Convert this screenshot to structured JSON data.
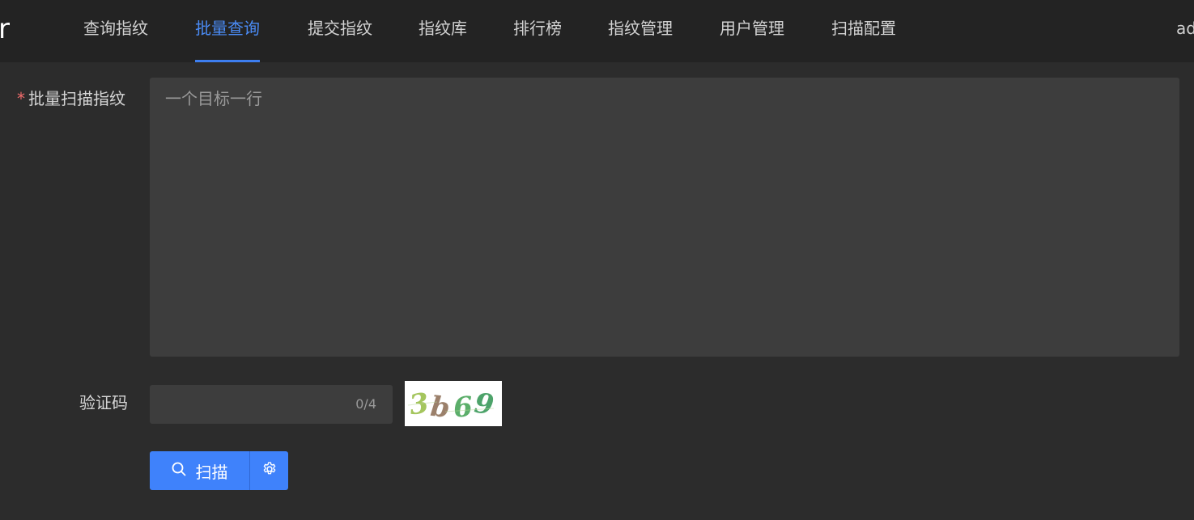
{
  "header": {
    "brand": "r",
    "nav": [
      {
        "label": "查询指纹",
        "active": false
      },
      {
        "label": "批量查询",
        "active": true
      },
      {
        "label": "提交指纹",
        "active": false
      },
      {
        "label": "指纹库",
        "active": false
      },
      {
        "label": "排行榜",
        "active": false
      },
      {
        "label": "指纹管理",
        "active": false
      },
      {
        "label": "用户管理",
        "active": false
      },
      {
        "label": "扫描配置",
        "active": false
      }
    ],
    "user": "ad"
  },
  "form": {
    "fingerprint_label": "批量扫描指纹",
    "required_mark": "*",
    "fingerprint_placeholder": "一个目标一行",
    "fingerprint_value": "",
    "captcha_label": "验证码",
    "captcha_value": "",
    "captcha_counter": "0/4",
    "captcha_text": "3b69",
    "scan_button": "扫描"
  },
  "colors": {
    "accent": "#3f82fb",
    "active_nav": "#4a8bf5",
    "required": "#f36c6c",
    "background": "#2c2c2c",
    "header_background": "#232323"
  },
  "icons": {
    "scan_button_icon": "search-icon",
    "settings_button_icon": "gear-icon"
  }
}
